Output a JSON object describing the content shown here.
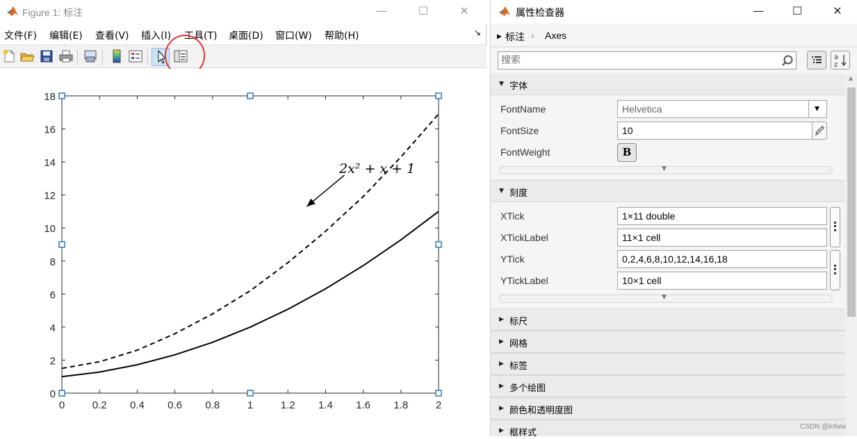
{
  "figure": {
    "title": "Figure 1: 标注",
    "menus": [
      "文件(F)",
      "编辑(E)",
      "查看(V)",
      "插入(I)",
      "工具(T)",
      "桌面(D)",
      "窗口(W)",
      "帮助(H)"
    ],
    "toolbar_icons": [
      "new-figure-icon",
      "open-file-icon",
      "save-icon",
      "print-icon",
      "link-plot-icon",
      "colorbar-icon",
      "legend-icon",
      "edit-plot-icon",
      "property-inspector-icon"
    ],
    "annotation_text": "2x² + x + 1"
  },
  "chart_data": {
    "type": "line",
    "title": "",
    "xlabel": "",
    "ylabel": "",
    "xlim": [
      0,
      2
    ],
    "ylim": [
      0,
      18
    ],
    "xticks": [
      0,
      0.2,
      0.4,
      0.6,
      0.8,
      1,
      1.2,
      1.4,
      1.6,
      1.8,
      2
    ],
    "xticklabels": [
      "0",
      "0.2",
      "0.4",
      "0.6",
      "0.8",
      "1",
      "1.2",
      "1.4",
      "1.6",
      "1.8",
      "2"
    ],
    "yticks": [
      0,
      2,
      4,
      6,
      8,
      10,
      12,
      14,
      16,
      18
    ],
    "yticklabels": [
      "0",
      "2",
      "4",
      "6",
      "8",
      "10",
      "12",
      "14",
      "16",
      "18"
    ],
    "grid": false,
    "series": [
      {
        "style": "dashed",
        "color": "#000000",
        "x": [
          0,
          0.2,
          0.4,
          0.6,
          0.8,
          1,
          1.2,
          1.4,
          1.6,
          1.8,
          2
        ],
        "y": [
          1.5,
          1.9,
          2.6,
          3.6,
          4.8,
          6.2,
          7.9,
          9.8,
          11.9,
          14.3,
          16.9
        ]
      },
      {
        "style": "solid",
        "color": "#000000",
        "x": [
          0,
          0.2,
          0.4,
          0.6,
          0.8,
          1,
          1.2,
          1.4,
          1.6,
          1.8,
          2
        ],
        "y": [
          1.0,
          1.28,
          1.72,
          2.32,
          3.08,
          4.0,
          5.08,
          6.32,
          7.72,
          9.28,
          11.0
        ]
      }
    ],
    "annotations": [
      {
        "text": "2x² + x + 1",
        "arrow_from": [
          1.5,
          13.2
        ],
        "arrow_to": [
          1.3,
          11.3
        ]
      }
    ]
  },
  "inspector": {
    "title": "属性检查器",
    "breadcrumb": [
      "标注",
      "Axes"
    ],
    "search_placeholder": "搜索",
    "sections": {
      "font": {
        "label": "字体",
        "props": [
          {
            "name": "FontName",
            "value": "Helvetica"
          },
          {
            "name": "FontSize",
            "value": "10"
          },
          {
            "name": "FontWeight",
            "value": "B"
          }
        ]
      },
      "ticks": {
        "label": "刻度",
        "props": [
          {
            "name": "XTick",
            "value": "1×11 double"
          },
          {
            "name": "XTickLabel",
            "value": "11×1 cell"
          },
          {
            "name": "YTick",
            "value": "0,2,4,6,8,10,12,14,16,18"
          },
          {
            "name": "YTickLabel",
            "value": "10×1 cell"
          }
        ]
      },
      "collapsed": [
        "标尺",
        "网格",
        "标签",
        "多个绘图",
        "颜色和透明度图",
        "框样式"
      ]
    }
  },
  "watermark": "CSDN @lnfww"
}
